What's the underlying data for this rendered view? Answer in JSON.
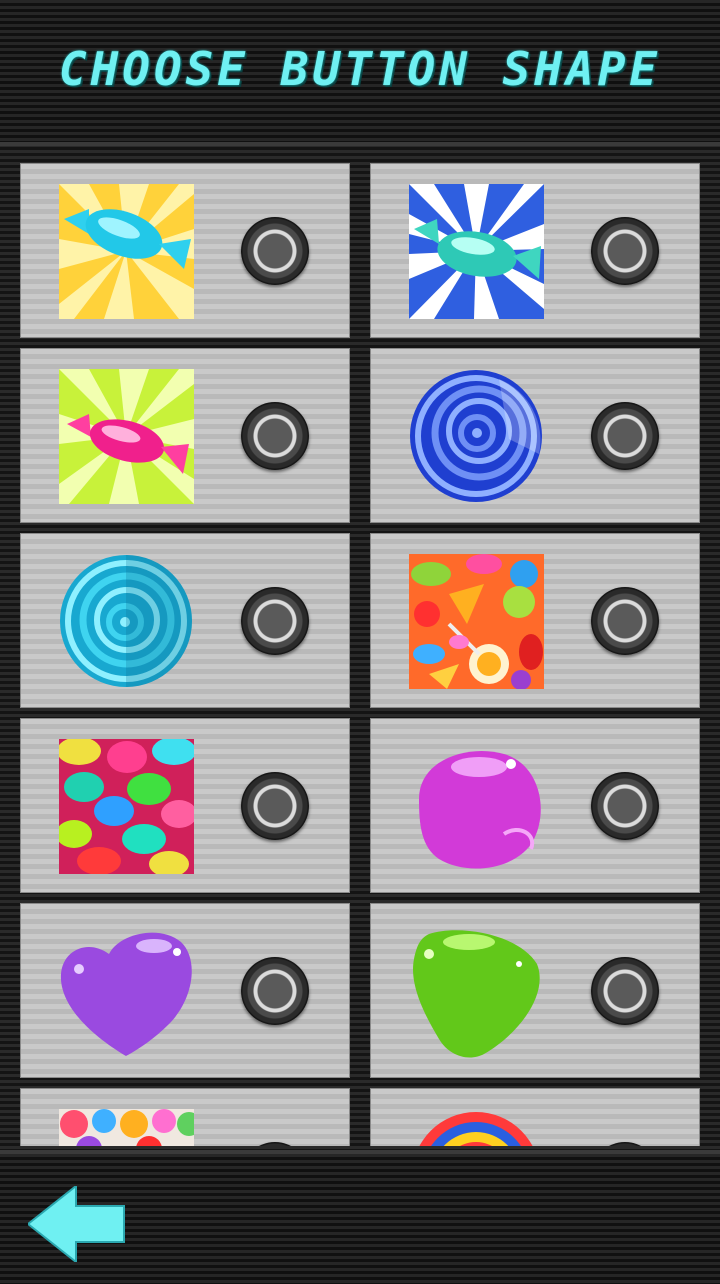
{
  "header": {
    "title": "CHOOSE BUTTON SHAPE"
  },
  "options": [
    {
      "icon": "wrapped-candy-blue-on-yellow-icon",
      "selected": false
    },
    {
      "icon": "wrapped-candy-teal-on-blue-icon",
      "selected": false
    },
    {
      "icon": "wrapped-candy-pink-on-green-icon",
      "selected": false
    },
    {
      "icon": "blue-swirl-lollipop-icon",
      "selected": false
    },
    {
      "icon": "cyan-swirl-lollipop-icon",
      "selected": false
    },
    {
      "icon": "candy-mix-pattern-icon",
      "selected": false
    },
    {
      "icon": "colorful-gumballs-icon",
      "selected": false
    },
    {
      "icon": "magenta-jelly-drop-icon",
      "selected": false
    },
    {
      "icon": "purple-jelly-heart-icon",
      "selected": false
    },
    {
      "icon": "green-jelly-drop-icon",
      "selected": false
    },
    {
      "icon": "lollipop-candy-pattern-icon",
      "selected": false
    },
    {
      "icon": "striped-ball-candy-icon",
      "selected": false
    }
  ],
  "footer": {
    "back_icon": "back-arrow-icon"
  },
  "colors": {
    "accent": "#6ff0f2"
  }
}
